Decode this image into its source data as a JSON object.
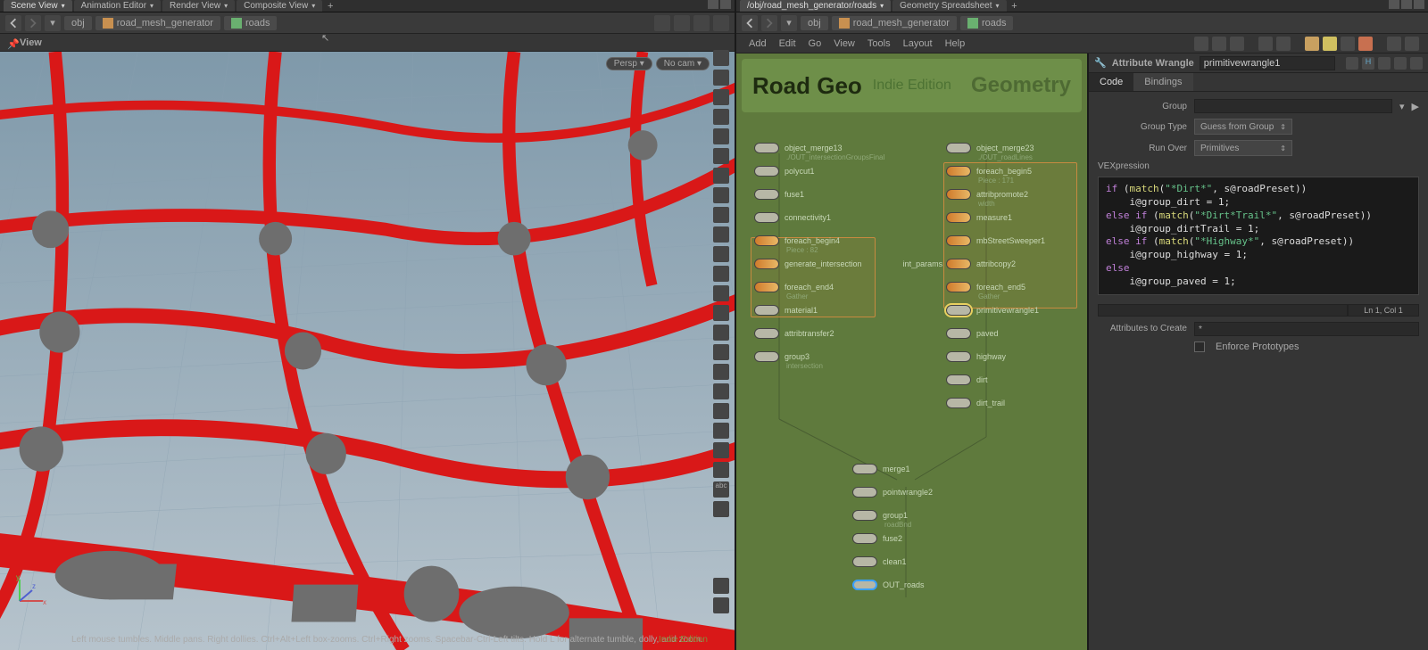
{
  "left": {
    "tabs": [
      "Scene View",
      "Animation Editor",
      "Render View",
      "Composite View"
    ],
    "activeTab": 0,
    "breadcrumb": {
      "root": "obj",
      "node": "road_mesh_generator",
      "sub": "roads"
    },
    "viewLabel": "View",
    "perspLabel": "Persp",
    "camLabel": "No cam",
    "statusLine": "Left mouse tumbles. Middle pans. Right dollies. Ctrl+Alt+Left box-zooms. Ctrl+Right zooms. Spacebar-Ctrl-Left tilts. Hold L for alternate tumble, dolly, and zoom.",
    "indie": "Indie Edition"
  },
  "right": {
    "tabs": [
      "/obj/road_mesh_generator/roads",
      "Geometry Spreadsheet"
    ],
    "breadcrumb": {
      "root": "obj",
      "node": "road_mesh_generator",
      "sub": "roads"
    },
    "menus": [
      "Add",
      "Edit",
      "Go",
      "View",
      "Tools",
      "Layout",
      "Help"
    ],
    "network": {
      "title": "Road Geo",
      "subtitle": "Indie Edition",
      "type": "Geometry",
      "leftCol": [
        {
          "label": "object_merge13",
          "sub": "./OUT_intersectionGroupsFinal"
        },
        {
          "label": "polycut1"
        },
        {
          "label": "fuse1"
        },
        {
          "label": "connectivity1"
        },
        {
          "label": "foreach_begin4",
          "sub": "Piece : 82",
          "loop": true
        },
        {
          "label": "generate_intersection",
          "loop": true,
          "extra": "int_params"
        },
        {
          "label": "foreach_end4",
          "sub": "Gather",
          "loop": true
        },
        {
          "label": "material1"
        },
        {
          "label": "attribtransfer2"
        },
        {
          "label": "group3",
          "sub": "intersection"
        }
      ],
      "rightCol": [
        {
          "label": "object_merge23",
          "sub": "./OUT_roadLines"
        },
        {
          "label": "foreach_begin5",
          "sub": "Piece : 171",
          "loop": true
        },
        {
          "label": "attribpromote2",
          "sub": "width",
          "loop": true
        },
        {
          "label": "measure1",
          "loop": true
        },
        {
          "label": "mbStreetSweeper1",
          "loop": true
        },
        {
          "label": "attribcopy2",
          "loop": true
        },
        {
          "label": "foreach_end5",
          "sub": "Gather",
          "loop": true
        },
        {
          "label": "primitivewrangle1",
          "selected": true
        },
        {
          "label": "paved"
        },
        {
          "label": "highway"
        },
        {
          "label": "dirt"
        },
        {
          "label": "dirt_trail"
        }
      ],
      "centerCol": [
        {
          "label": "merge1"
        },
        {
          "label": "pointwrangle2"
        },
        {
          "label": "group1",
          "sub": "roadBnd"
        },
        {
          "label": "fuse2"
        },
        {
          "label": "clean1"
        },
        {
          "label": "OUT_roads",
          "out": true
        }
      ]
    },
    "param": {
      "nodeType": "Attribute Wrangle",
      "nodeName": "primitivewrangle1",
      "tabs": [
        "Code",
        "Bindings"
      ],
      "groupLabel": "Group",
      "groupTypeLabel": "Group Type",
      "groupTypeValue": "Guess from Group",
      "runOverLabel": "Run Over",
      "runOverValue": "Primitives",
      "vexLabel": "VEXpression",
      "code": {
        "l1a": "if",
        "l1b": " (",
        "l1c": "match",
        "l1d": "(",
        "l1e": "\"*Dirt*\"",
        "l1f": ", s@roadPreset))",
        "l2": "    i@group_dirt = 1;",
        "l3a": "else if",
        "l3b": " (",
        "l3c": "match",
        "l3d": "(",
        "l3e": "\"*Dirt*Trail*\"",
        "l3f": ", s@roadPreset))",
        "l4": "    i@group_dirtTrail = 1;",
        "l5a": "else if",
        "l5b": " (",
        "l5c": "match",
        "l5d": "(",
        "l5e": "\"*Highway*\"",
        "l5f": ", s@roadPreset))",
        "l6": "    i@group_highway = 1;",
        "l7": "else",
        "l8": "    i@group_paved = 1;"
      },
      "cursor": "Ln 1, Col 1",
      "attrsLabel": "Attributes to Create",
      "attrsValue": "*",
      "enforceLabel": "Enforce Prototypes"
    }
  }
}
